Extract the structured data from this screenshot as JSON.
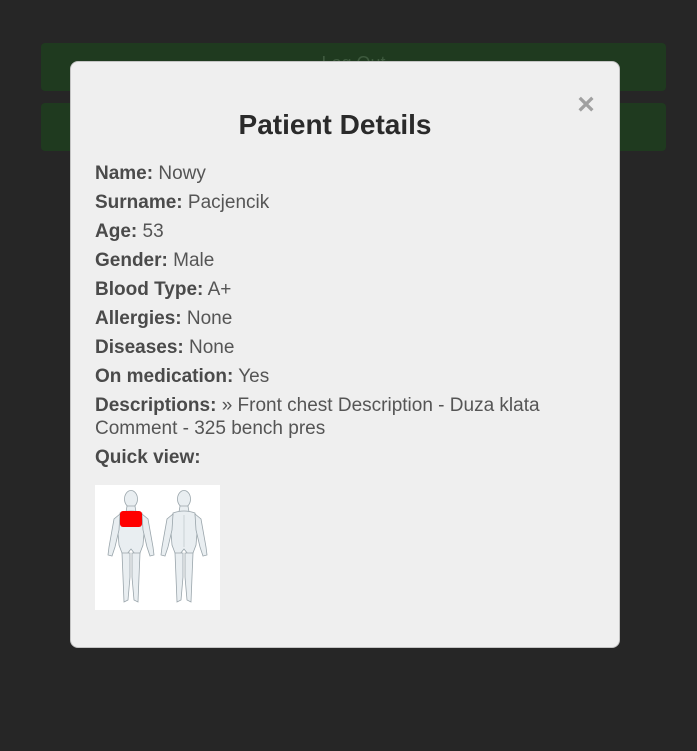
{
  "background": {
    "buttons": [
      {
        "label": "Log Out"
      },
      {
        "label": ""
      }
    ]
  },
  "modal": {
    "title": "Patient Details",
    "close_glyph": "×",
    "fields": [
      {
        "label": "Name:",
        "value": "Nowy"
      },
      {
        "label": "Surname:",
        "value": "Pacjencik"
      },
      {
        "label": "Age:",
        "value": "53"
      },
      {
        "label": "Gender:",
        "value": "Male"
      },
      {
        "label": "Blood Type:",
        "value": "A+"
      },
      {
        "label": "Allergies:",
        "value": "None"
      },
      {
        "label": "Diseases:",
        "value": "None"
      },
      {
        "label": "On medication:",
        "value": "Yes"
      },
      {
        "label": "Descriptions:",
        "value": "» Front chest Description - Duza klata Comment - 325 bench pres"
      }
    ],
    "quick_view_label": "Quick view:",
    "highlight_color": "#ff0000"
  }
}
